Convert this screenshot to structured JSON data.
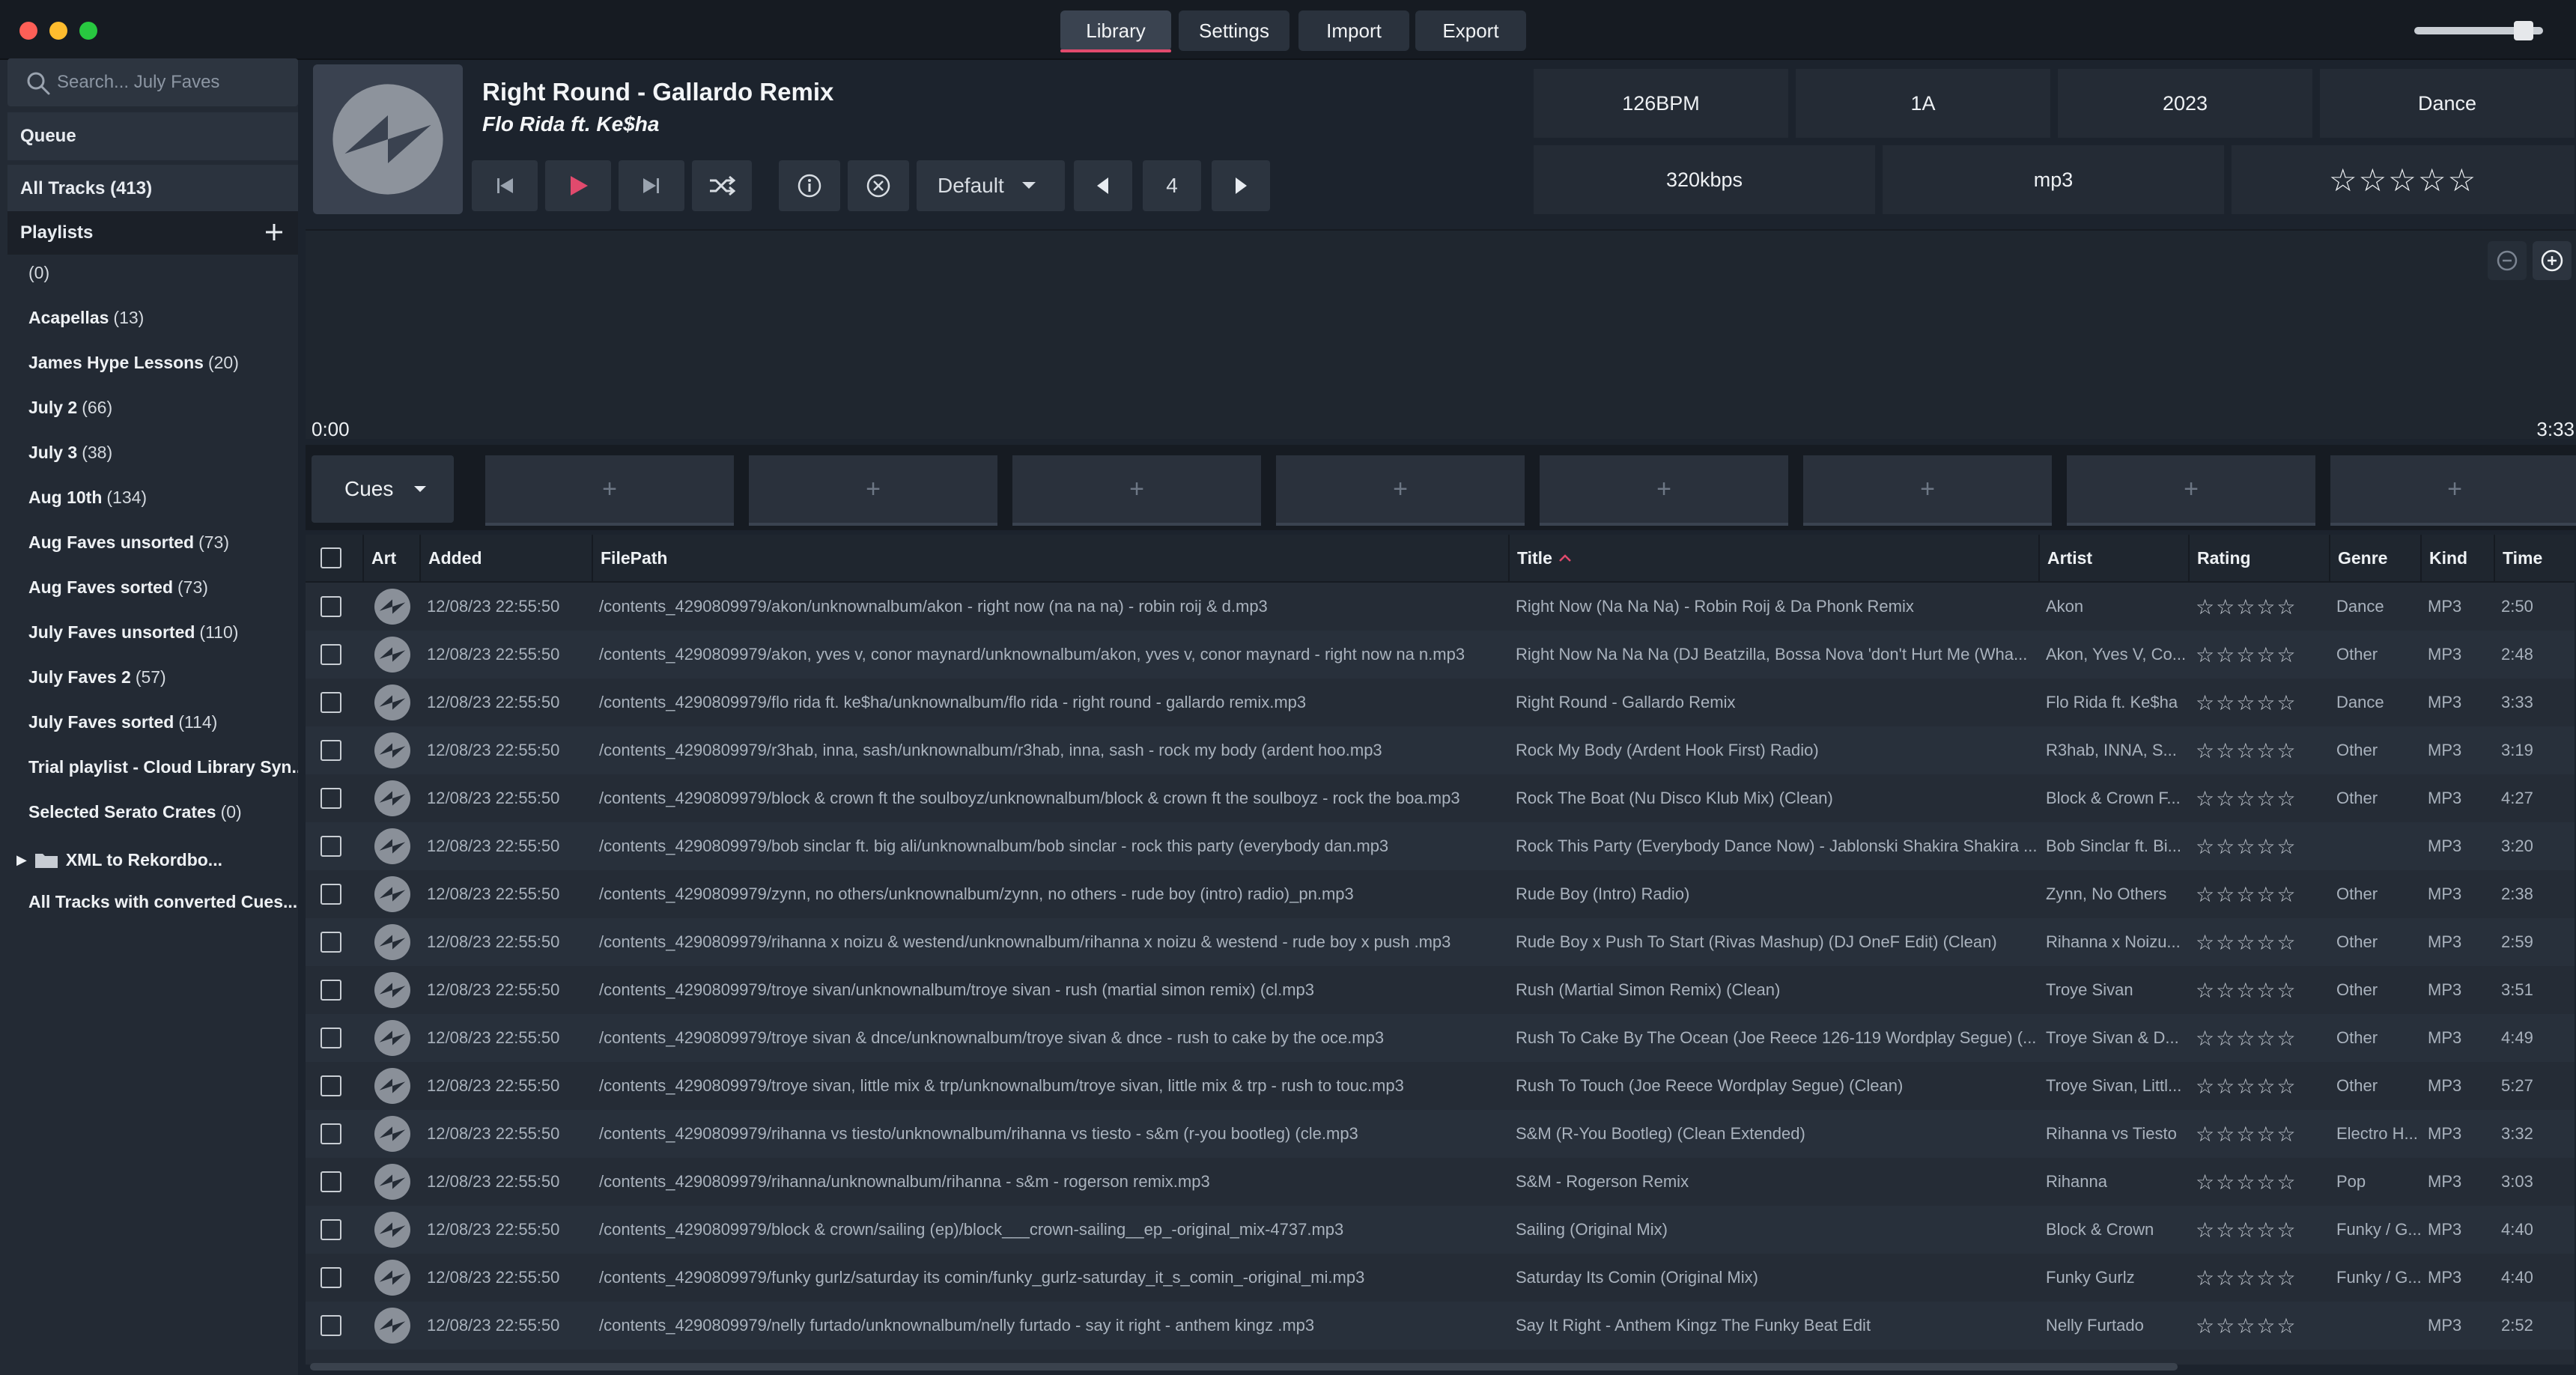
{
  "window": {
    "tabs": [
      {
        "label": "Library",
        "active": true
      },
      {
        "label": "Settings",
        "active": false
      },
      {
        "label": "Import",
        "active": false
      },
      {
        "label": "Export",
        "active": false
      }
    ],
    "volume_level": 0.85
  },
  "sidebar": {
    "search_placeholder": "Search... July Faves",
    "queue_label": "Queue",
    "all_tracks_label": "All Tracks (413)",
    "playlists_label": "Playlists",
    "playlists": [
      {
        "name": "",
        "count": "(0)"
      },
      {
        "name": "Acapellas",
        "count": "(13)"
      },
      {
        "name": "James Hype Lessons",
        "count": "(20)"
      },
      {
        "name": "July 2",
        "count": "(66)"
      },
      {
        "name": "July 3",
        "count": "(38)"
      },
      {
        "name": "Aug 10th",
        "count": "(134)"
      },
      {
        "name": "Aug Faves unsorted",
        "count": "(73)"
      },
      {
        "name": "Aug Faves sorted",
        "count": "(73)"
      },
      {
        "name": "July Faves unsorted",
        "count": "(110)"
      },
      {
        "name": "July Faves 2",
        "count": "(57)"
      },
      {
        "name": "July Faves sorted",
        "count": "(114)"
      },
      {
        "name": "Trial playlist - Cloud Library Syn...",
        "count": ""
      },
      {
        "name": "Selected Serato Crates",
        "count": "(0)"
      }
    ],
    "folder_label": "XML to Rekordbo...",
    "last_item": "All Tracks with converted Cues..."
  },
  "now_playing": {
    "title": "Right Round - Gallardo Remix",
    "artist": "Flo Rida ft. Ke$ha",
    "mode_label": "Default",
    "loop_value": "4",
    "bpm": "126BPM",
    "key": "1A",
    "year": "2023",
    "genre": "Dance",
    "bitrate": "320kbps",
    "format": "mp3",
    "rating_stars": "☆☆☆☆☆"
  },
  "waveform": {
    "time_start": "0:00",
    "time_end": "3:33"
  },
  "cues": {
    "label": "Cues",
    "slot_icon": "+"
  },
  "table": {
    "headers": {
      "art": "Art",
      "added": "Added",
      "filepath": "FilePath",
      "title": "Title",
      "artist": "Artist",
      "rating": "Rating",
      "genre": "Genre",
      "kind": "Kind",
      "time": "Time"
    },
    "sort_column": "title",
    "sort_direction": "ascending",
    "rows": [
      {
        "added": "12/08/23 22:55:50",
        "filepath": "/contents_4290809979/akon/unknownalbum/akon - right now (na na na) - robin roij & d.mp3",
        "title": "Right Now (Na Na Na) - Robin Roij & Da Phonk Remix",
        "artist": "Akon",
        "rating": "☆☆☆☆☆",
        "genre": "Dance",
        "kind": "MP3",
        "time": "2:50"
      },
      {
        "added": "12/08/23 22:55:50",
        "filepath": "/contents_4290809979/akon, yves v, conor maynard/unknownalbum/akon, yves v, conor maynard - right now na n.mp3",
        "title": "Right Now Na Na Na (DJ Beatzilla, Bossa Nova 'don't Hurt Me (Wha...",
        "artist": "Akon, Yves V, Co...",
        "rating": "☆☆☆☆☆",
        "genre": "Other",
        "kind": "MP3",
        "time": "2:48"
      },
      {
        "added": "12/08/23 22:55:50",
        "filepath": "/contents_4290809979/flo rida ft. ke$ha/unknownalbum/flo rida - right round - gallardo remix.mp3",
        "title": "Right Round - Gallardo Remix",
        "artist": "Flo Rida ft. Ke$ha",
        "rating": "☆☆☆☆☆",
        "genre": "Dance",
        "kind": "MP3",
        "time": "3:33"
      },
      {
        "added": "12/08/23 22:55:50",
        "filepath": "/contents_4290809979/r3hab, inna, sash/unknownalbum/r3hab, inna, sash - rock my body (ardent hoo.mp3",
        "title": "Rock My Body (Ardent Hook First) Radio)",
        "artist": "R3hab, INNA, S...",
        "rating": "☆☆☆☆☆",
        "genre": "Other",
        "kind": "MP3",
        "time": "3:19"
      },
      {
        "added": "12/08/23 22:55:50",
        "filepath": "/contents_4290809979/block & crown ft the soulboyz/unknownalbum/block & crown ft the soulboyz - rock the boa.mp3",
        "title": "Rock The Boat (Nu Disco Klub Mix) (Clean)",
        "artist": "Block & Crown F...",
        "rating": "☆☆☆☆☆",
        "genre": "Other",
        "kind": "MP3",
        "time": "4:27"
      },
      {
        "added": "12/08/23 22:55:50",
        "filepath": "/contents_4290809979/bob sinclar ft. big ali/unknownalbum/bob sinclar - rock this party (everybody dan.mp3",
        "title": "Rock This Party (Everybody Dance Now) - Jablonski Shakira Shakira ...",
        "artist": "Bob Sinclar ft. Bi...",
        "rating": "☆☆☆☆☆",
        "genre": "",
        "kind": "MP3",
        "time": "3:20"
      },
      {
        "added": "12/08/23 22:55:50",
        "filepath": "/contents_4290809979/zynn, no others/unknownalbum/zynn, no others - rude boy (intro) radio)_pn.mp3",
        "title": "Rude Boy (Intro) Radio)",
        "artist": "Zynn, No Others",
        "rating": "☆☆☆☆☆",
        "genre": "Other",
        "kind": "MP3",
        "time": "2:38"
      },
      {
        "added": "12/08/23 22:55:50",
        "filepath": "/contents_4290809979/rihanna x noizu & westend/unknownalbum/rihanna x noizu & westend - rude boy x push .mp3",
        "title": "Rude Boy x Push To Start (Rivas Mashup) (DJ OneF Edit) (Clean)",
        "artist": "Rihanna x Noizu...",
        "rating": "☆☆☆☆☆",
        "genre": "Other",
        "kind": "MP3",
        "time": "2:59"
      },
      {
        "added": "12/08/23 22:55:50",
        "filepath": "/contents_4290809979/troye sivan/unknownalbum/troye sivan - rush (martial simon remix) (cl.mp3",
        "title": "Rush (Martial Simon Remix) (Clean)",
        "artist": "Troye Sivan",
        "rating": "☆☆☆☆☆",
        "genre": "Other",
        "kind": "MP3",
        "time": "3:51"
      },
      {
        "added": "12/08/23 22:55:50",
        "filepath": "/contents_4290809979/troye sivan & dnce/unknownalbum/troye sivan & dnce - rush to cake by the oce.mp3",
        "title": "Rush To Cake By The Ocean (Joe Reece 126-119 Wordplay Segue) (...",
        "artist": "Troye Sivan & D...",
        "rating": "☆☆☆☆☆",
        "genre": "Other",
        "kind": "MP3",
        "time": "4:49"
      },
      {
        "added": "12/08/23 22:55:50",
        "filepath": "/contents_4290809979/troye sivan, little mix & trp/unknownalbum/troye sivan, little mix & trp - rush to touc.mp3",
        "title": "Rush To Touch (Joe Reece Wordplay Segue) (Clean)",
        "artist": "Troye Sivan, Littl...",
        "rating": "☆☆☆☆☆",
        "genre": "Other",
        "kind": "MP3",
        "time": "5:27"
      },
      {
        "added": "12/08/23 22:55:50",
        "filepath": "/contents_4290809979/rihanna vs tiesto/unknownalbum/rihanna vs tiesto - s&m (r-you bootleg) (cle.mp3",
        "title": "S&M (R-You Bootleg) (Clean Extended)",
        "artist": "Rihanna vs Tiesto",
        "rating": "☆☆☆☆☆",
        "genre": "Electro H...",
        "kind": "MP3",
        "time": "3:32"
      },
      {
        "added": "12/08/23 22:55:50",
        "filepath": "/contents_4290809979/rihanna/unknownalbum/rihanna - s&m - rogerson remix.mp3",
        "title": "S&M - Rogerson Remix",
        "artist": "Rihanna",
        "rating": "☆☆☆☆☆",
        "genre": "Pop",
        "kind": "MP3",
        "time": "3:03"
      },
      {
        "added": "12/08/23 22:55:50",
        "filepath": "/contents_4290809979/block & crown/sailing (ep)/block___crown-sailing__ep_-original_mix-4737.mp3",
        "title": "Sailing (Original Mix)",
        "artist": "Block & Crown",
        "rating": "☆☆☆☆☆",
        "genre": "Funky / G...",
        "kind": "MP3",
        "time": "4:40"
      },
      {
        "added": "12/08/23 22:55:50",
        "filepath": "/contents_4290809979/funky gurlz/saturday its comin/funky_gurlz-saturday_it_s_comin_-original_mi.mp3",
        "title": "Saturday Its Comin (Original Mix)",
        "artist": "Funky Gurlz",
        "rating": "☆☆☆☆☆",
        "genre": "Funky / G...",
        "kind": "MP3",
        "time": "4:40"
      },
      {
        "added": "12/08/23 22:55:50",
        "filepath": "/contents_4290809979/nelly furtado/unknownalbum/nelly furtado - say it right - anthem kingz .mp3",
        "title": "Say It Right - Anthem Kingz The Funky Beat Edit",
        "artist": "Nelly Furtado",
        "rating": "☆☆☆☆☆",
        "genre": "",
        "kind": "MP3",
        "time": "2:52"
      }
    ]
  }
}
